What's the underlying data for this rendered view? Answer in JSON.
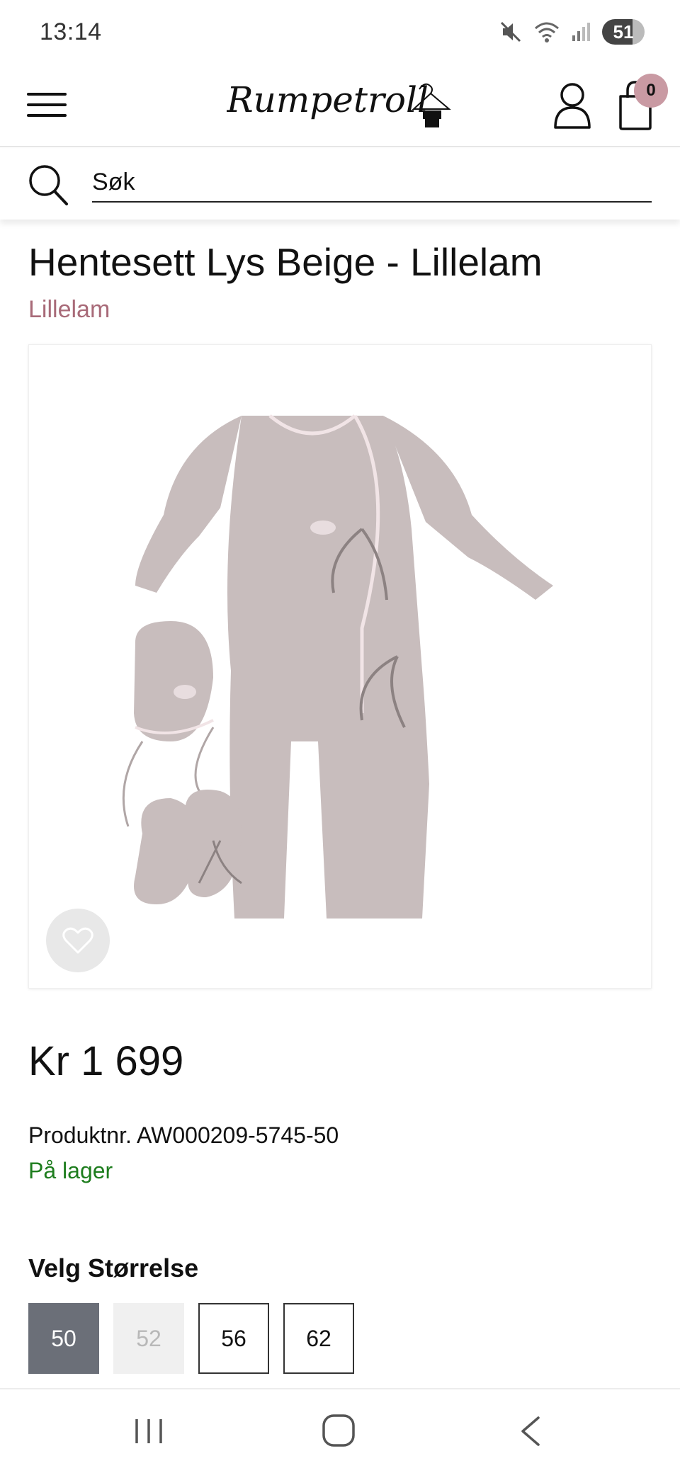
{
  "status_bar": {
    "time": "13:14",
    "battery": "51",
    "icons": [
      "mute-icon",
      "wifi-icon",
      "signal-icon",
      "battery-icon"
    ]
  },
  "header": {
    "logo_text": "Rumpetroll",
    "cart_count": "0",
    "icons": [
      "menu-icon",
      "account-icon",
      "cart-icon"
    ]
  },
  "search": {
    "placeholder": "Søk"
  },
  "product": {
    "title": "Hentesett Lys Beige - Lillelam",
    "brand": "Lillelam",
    "price": "Kr 1 699",
    "sku": "Produktnr. AW000209-5745-50",
    "stock": "På lager",
    "image_alt": "knitted beige baby set with overall, hat and booties"
  },
  "sizes": {
    "heading": "Velg Størrelse",
    "options": [
      {
        "label": "50",
        "state": "selected"
      },
      {
        "label": "52",
        "state": "disabled"
      },
      {
        "label": "56",
        "state": "available"
      },
      {
        "label": "62",
        "state": "available"
      }
    ]
  },
  "colors": {
    "brand_pink": "#a86a78",
    "badge_pink": "#c99aa3",
    "stock_green": "#1e7d1e",
    "selected_grey": "#6b6f78",
    "garment": "#c8bdbd"
  }
}
